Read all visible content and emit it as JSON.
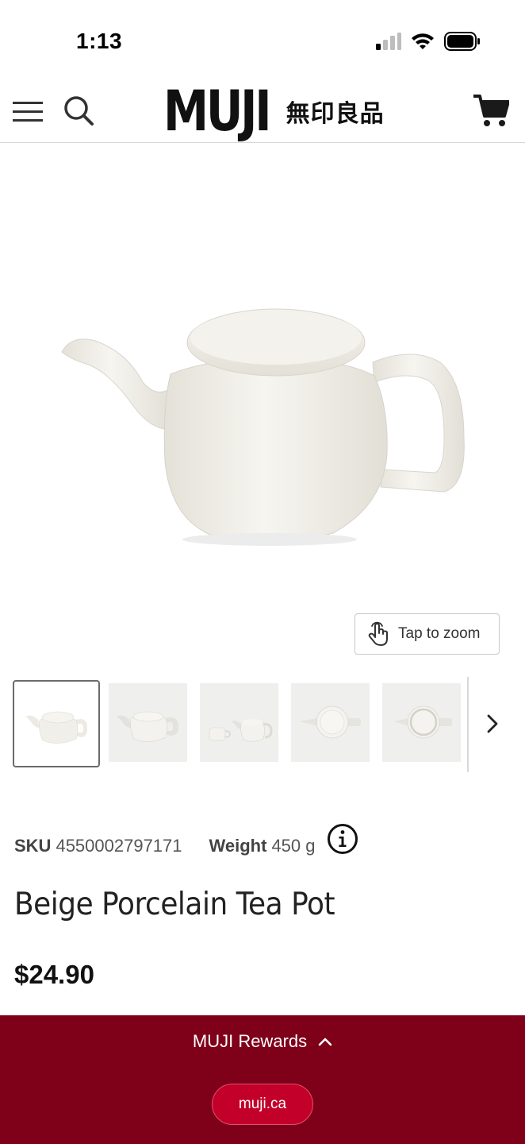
{
  "status_bar": {
    "time": "1:13"
  },
  "header": {
    "brand": "MUJI",
    "brand_japanese": "無印良品"
  },
  "gallery": {
    "zoom_label": "Tap to zoom",
    "thumbnail_count_visible": 5,
    "selected_index": 0
  },
  "product": {
    "sku_label": "SKU",
    "sku": "4550002797171",
    "weight_label": "Weight",
    "weight": "450 g",
    "title": "Beige Porcelain Tea Pot",
    "price": "$24.90"
  },
  "rewards_bar": {
    "label": "MUJI Rewards",
    "url": "muji.ca"
  },
  "colors": {
    "rewards_background": "#7f0019",
    "url_pill": "#c3002a"
  }
}
